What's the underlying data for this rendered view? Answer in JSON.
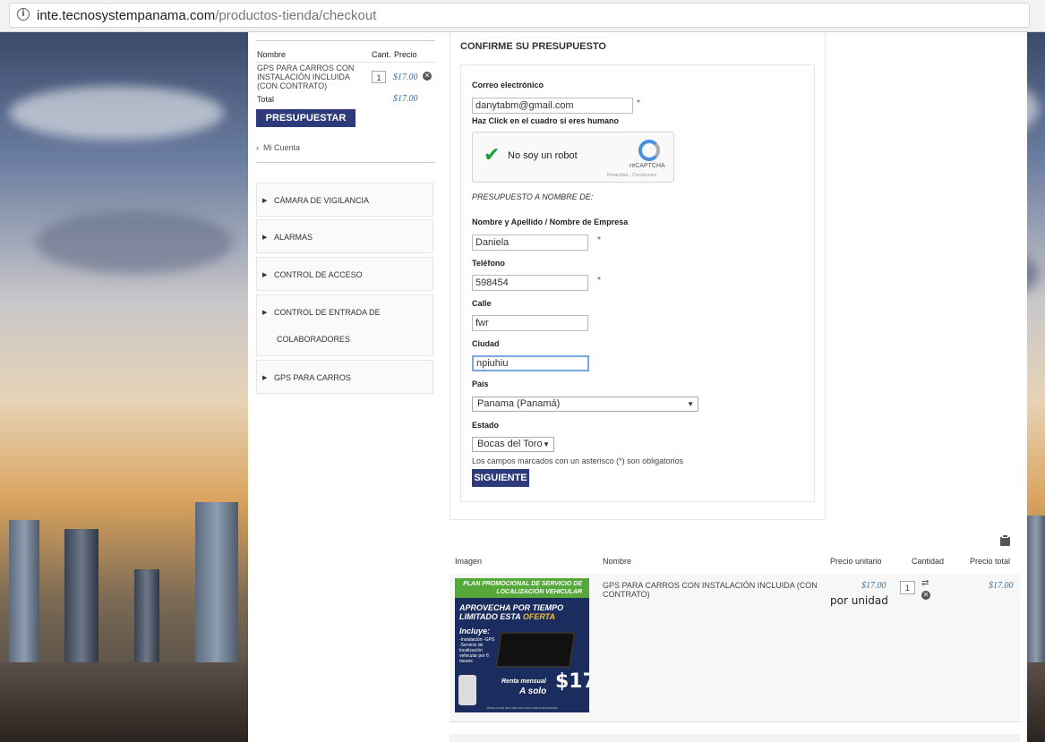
{
  "browser": {
    "url_domain": "inte.tecnosystempanama.com",
    "url_path": "/productos-tienda/checkout"
  },
  "cart": {
    "col_name": "Nombre",
    "col_qty": "Cant.",
    "col_price": "Precio",
    "item_name": "GPS PARA CARROS CON INSTALACIÓN INCLUIDA (CON CONTRATO)",
    "item_qty": "1",
    "item_price": "$17.00",
    "total_label": "Total",
    "total_value": "$17.00",
    "button_label": "PRESUPUESTAR",
    "account_link": "Mi Cuenta"
  },
  "categories": [
    {
      "label": "CÁMARA DE VIGILANCIA"
    },
    {
      "label": "ALARMAS"
    },
    {
      "label": "CONTROL DE ACCESO"
    },
    {
      "label_line1": "CONTROL DE ENTRADA DE",
      "label_line2": "COLABORADORES"
    },
    {
      "label": "GPS PARA CARROS"
    }
  ],
  "form": {
    "title": "CONFIRME SU PRESUPUESTO",
    "email_label": "Correo electrónico",
    "email_value": "danytabm@gmail.com",
    "human_label": "Haz Click en el cuadro si eres humano",
    "recaptcha_text": "No soy un robot",
    "recaptcha_brand": "reCAPTCHA",
    "recaptcha_terms": "Privacidad - Condiciones",
    "section_label": "PRESUPUESTO A NOMBRE DE:",
    "name_label": "Nombre y Apellido / Nombre de Empresa",
    "name_value": "Daniela",
    "phone_label": "Teléfono",
    "phone_value": "598454",
    "street_label": "Calle",
    "street_value": "fwr",
    "city_label": "Ciudad",
    "city_value": "npiuhiu",
    "country_label": "País",
    "country_value": "Panama (Panamá)",
    "state_label": "Estado",
    "state_value": "Bocas del Toro",
    "required_mark": "*",
    "required_note": "Los campos marcados con un asterisco (*) son obligatorios",
    "submit_label": "SIGUIENTE"
  },
  "product_table": {
    "headers": [
      "Imagen",
      "Nombre",
      "Precio unitario",
      "Cantidad",
      "Precio total"
    ],
    "row": {
      "name": "GPS PARA CARROS CON INSTALACIÓN INCLUIDA (CON CONTRATO)",
      "unit_price": "$17.00",
      "per_unit": "por unidad",
      "qty": "1",
      "total": "$17.00"
    },
    "promo": {
      "top": "PLAN PROMOCIONAL DE SERVICIO DE LOCALIZACIÓN VEHICULAR",
      "line1": "APROVECHA POR TIEMPO",
      "line2a": "LIMITADO ESTA ",
      "line2b": "OFERTA",
      "includes": "Incluye:",
      "list": "-Instalación -GPS -Servicio de localización vehicular por 6 meses",
      "renta": "Renta mensual",
      "asolo": "A solo",
      "price": "$17",
      "footer": "INSTALACIÓN INCLUIDA SOLO EN CIUDAD DE PANAMÁ"
    }
  }
}
